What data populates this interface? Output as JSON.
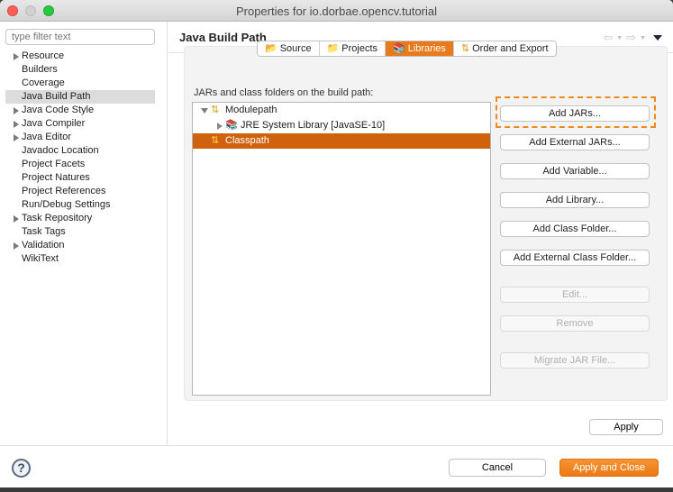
{
  "window": {
    "title": "Properties for io.dorbae.opencv.tutorial"
  },
  "sidebar": {
    "filter_placeholder": "type filter text",
    "items": [
      {
        "label": "Resource",
        "expandable": true
      },
      {
        "label": "Builders",
        "expandable": false
      },
      {
        "label": "Coverage",
        "expandable": false
      },
      {
        "label": "Java Build Path",
        "expandable": false,
        "selected": true
      },
      {
        "label": "Java Code Style",
        "expandable": true
      },
      {
        "label": "Java Compiler",
        "expandable": true
      },
      {
        "label": "Java Editor",
        "expandable": true
      },
      {
        "label": "Javadoc Location",
        "expandable": false
      },
      {
        "label": "Project Facets",
        "expandable": false
      },
      {
        "label": "Project Natures",
        "expandable": false
      },
      {
        "label": "Project References",
        "expandable": false
      },
      {
        "label": "Run/Debug Settings",
        "expandable": false
      },
      {
        "label": "Task Repository",
        "expandable": true
      },
      {
        "label": "Task Tags",
        "expandable": false
      },
      {
        "label": "Validation",
        "expandable": true
      },
      {
        "label": "WikiText",
        "expandable": false
      }
    ]
  },
  "header": {
    "page_title": "Java Build Path",
    "nav_back_icon": "back-arrow-icon",
    "nav_forward_icon": "forward-arrow-icon",
    "menu_icon": "view-menu-icon"
  },
  "tabs": [
    {
      "label": "Source",
      "icon": "source-folder-icon",
      "glyph": "📂"
    },
    {
      "label": "Projects",
      "icon": "projects-folder-icon",
      "glyph": "📁"
    },
    {
      "label": "Libraries",
      "icon": "libraries-icon",
      "glyph": "📚",
      "active": true
    },
    {
      "label": "Order and Export",
      "icon": "order-export-icon",
      "glyph": "⇅"
    }
  ],
  "libraries": {
    "label": "JARs and class folders on the build path:",
    "tree": [
      {
        "label": "Modulepath",
        "level": 0,
        "expanded": true,
        "icon": "modulepath-icon",
        "glyph": "⇅"
      },
      {
        "label": "JRE System Library [JavaSE-10]",
        "level": 1,
        "expanded": false,
        "icon": "library-icon",
        "glyph": "📚"
      },
      {
        "label": "Classpath",
        "level": 0,
        "selected": true,
        "icon": "classpath-icon",
        "glyph": "⇅"
      }
    ]
  },
  "buttons": {
    "add_jars": "Add JARs...",
    "add_external_jars": "Add External JARs...",
    "add_variable": "Add Variable...",
    "add_library": "Add Library...",
    "add_class_folder": "Add Class Folder...",
    "add_external_class_folder": "Add External Class Folder...",
    "edit": "Edit...",
    "remove": "Remove",
    "migrate_jar": "Migrate JAR File...",
    "apply": "Apply",
    "cancel": "Cancel",
    "apply_and_close": "Apply and Close"
  },
  "colors": {
    "accent": "#e97a1a",
    "selection": "#d0620e",
    "highlight_outline": "#f08a1a"
  }
}
